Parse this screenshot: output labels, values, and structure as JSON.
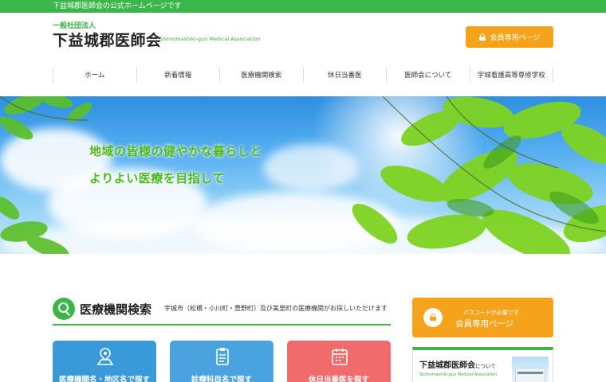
{
  "topbar": {
    "text": "下益城郡医師会の公式ホームページです"
  },
  "logo": {
    "small": "一般社団法人",
    "main": "下益城郡医師会",
    "english": "Shimomashiki-gun Medical Association"
  },
  "header": {
    "member_button": "会員専用ページ"
  },
  "nav": {
    "items": [
      {
        "label": "ホーム"
      },
      {
        "label": "新着情報"
      },
      {
        "label": "医療機関検索"
      },
      {
        "label": "休日当番医"
      },
      {
        "label": "医師会について"
      },
      {
        "label": "宇城看護高等専修学校"
      }
    ]
  },
  "hero": {
    "line1": "地域の皆様の健やかな暮らしと",
    "line2": "よりよい医療を目指して"
  },
  "search_section": {
    "title": "医療機関検索",
    "subtitle": "宇城市（松橋・小川町・豊野町）及び美里町の医療機関がお探しいただけます",
    "cards": [
      {
        "label": "医療機関名・地区名で探す",
        "color": "#3a9ad9",
        "icon": "map-pin-icon"
      },
      {
        "label": "診療科目名で探す",
        "color": "#4aa3df",
        "icon": "clipboard-icon"
      },
      {
        "label": "休日当番医を探す",
        "color": "#f06b6b",
        "icon": "calendar-icon"
      }
    ]
  },
  "sidebar": {
    "member_box": {
      "sub": "パスコードが必要です",
      "main": "会員専用ページ"
    },
    "about_box": {
      "title": "下益城郡医師会",
      "title_suffix": "について",
      "english": "Shimomashiki-gun Medical Association"
    }
  },
  "colors": {
    "brand_green": "#3cb54a",
    "accent_orange": "#f5a31a"
  }
}
